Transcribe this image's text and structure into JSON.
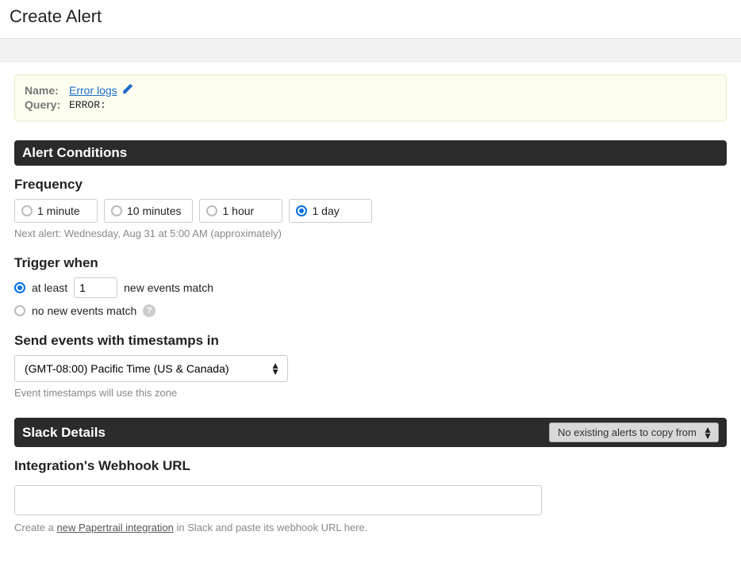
{
  "page": {
    "title": "Create Alert"
  },
  "summary": {
    "name_label": "Name:",
    "name_value": "Error logs",
    "query_label": "Query:",
    "query_value": "ERROR:"
  },
  "sections": {
    "conditions_title": "Alert Conditions",
    "slack_title": "Slack Details"
  },
  "frequency": {
    "heading": "Frequency",
    "options": [
      "1 minute",
      "10 minutes",
      "1 hour",
      "1 day"
    ],
    "selected_index": 3,
    "next_alert_hint": "Next alert: Wednesday, Aug 31 at 5:00 AM (approximately)"
  },
  "trigger": {
    "heading": "Trigger when",
    "at_least_prefix": "at least",
    "at_least_count": "1",
    "at_least_suffix": "new events match",
    "no_new_label": "no new events match",
    "selected": "at_least"
  },
  "timezone": {
    "heading": "Send events with timestamps in",
    "value": "(GMT-08:00) Pacific Time (US & Canada)",
    "hint": "Event timestamps will use this zone"
  },
  "slack": {
    "copy_dropdown": "No existing alerts to copy from…",
    "webhook_heading": "Integration's Webhook URL",
    "webhook_value": "",
    "footer_prefix": "Create a ",
    "footer_link": "new Papertrail integration",
    "footer_suffix": " in Slack and paste its webhook URL here."
  }
}
